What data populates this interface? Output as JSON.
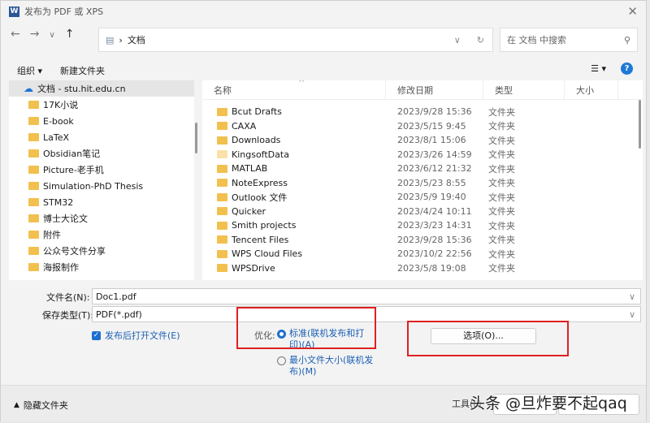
{
  "window": {
    "title": "发布为 PDF 或 XPS",
    "app_icon": "W"
  },
  "nav": {
    "path": "文档",
    "search_placeholder": "在 文档 中搜索"
  },
  "toolbar": {
    "organize": "组织 ▾",
    "new_folder": "新建文件夹"
  },
  "sidebar": {
    "items": [
      {
        "label": "文档 - stu.hit.edu.cn",
        "icon": "cloud-icon"
      },
      {
        "label": "17K小说"
      },
      {
        "label": "E-book"
      },
      {
        "label": "LaTeX"
      },
      {
        "label": "Obsidian笔记"
      },
      {
        "label": "Picture-老手机"
      },
      {
        "label": "Simulation-PhD Thesis"
      },
      {
        "label": "STM32"
      },
      {
        "label": "博士大论文"
      },
      {
        "label": "附件"
      },
      {
        "label": "公众号文件分享"
      },
      {
        "label": "海报制作"
      }
    ]
  },
  "list": {
    "columns": [
      "名称",
      "修改日期",
      "类型",
      "大小"
    ],
    "rows": [
      {
        "name": "Bcut Drafts",
        "date": "2023/9/28 15:36",
        "type": "文件夹"
      },
      {
        "name": "CAXA",
        "date": "2023/5/15 9:45",
        "type": "文件夹"
      },
      {
        "name": "Downloads",
        "date": "2023/8/1 15:06",
        "type": "文件夹"
      },
      {
        "name": "KingsoftData",
        "date": "2023/3/26 14:59",
        "type": "文件夹"
      },
      {
        "name": "MATLAB",
        "date": "2023/6/12 21:32",
        "type": "文件夹"
      },
      {
        "name": "NoteExpress",
        "date": "2023/5/23 8:55",
        "type": "文件夹"
      },
      {
        "name": "Outlook 文件",
        "date": "2023/5/9 19:40",
        "type": "文件夹"
      },
      {
        "name": "Quicker",
        "date": "2023/4/24 10:11",
        "type": "文件夹"
      },
      {
        "name": "Smith projects",
        "date": "2023/3/23 14:31",
        "type": "文件夹"
      },
      {
        "name": "Tencent Files",
        "date": "2023/9/28 15:36",
        "type": "文件夹"
      },
      {
        "name": "WPS Cloud Files",
        "date": "2023/10/2 22:56",
        "type": "文件夹"
      },
      {
        "name": "WPSDrive",
        "date": "2023/5/8 19:08",
        "type": "文件夹"
      }
    ]
  },
  "form": {
    "filename_label": "文件名(N):",
    "filename_value": "Doc1.pdf",
    "type_label": "保存类型(T):",
    "type_value": "PDF(*.pdf)",
    "open_after": "发布后打开文件(E)",
    "optimize_label": "优化:",
    "opt_standard": "标准(联机发布和打印)(A)",
    "opt_min": "最小文件大小(联机发布)(M)",
    "options_button": "选项(O)..."
  },
  "footer": {
    "hide_folders": "隐藏文件夹",
    "tools": "工具(L)"
  },
  "watermark": "头条 @旦炸要不起qaq",
  "colors": {
    "accent": "#1e6fd0",
    "highlight": "#e02020"
  }
}
